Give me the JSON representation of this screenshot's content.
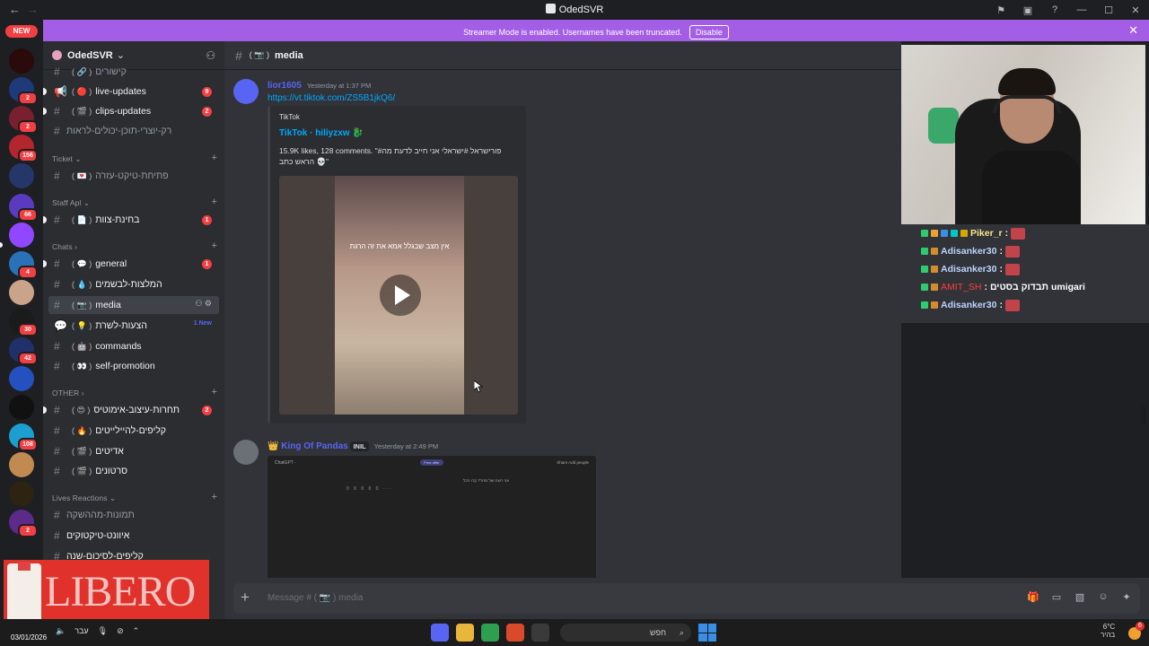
{
  "window": {
    "title": "OdedSVR"
  },
  "banner": {
    "message": "Streamer Mode is enabled. Usernames have been truncated.",
    "disable_label": "Disable"
  },
  "guild_bar": {
    "new_label": "NEW",
    "badges": [
      "2",
      "2",
      "156",
      "66",
      "4",
      "30",
      "42",
      "108",
      "2"
    ]
  },
  "server": {
    "name": "OdedSVR"
  },
  "sidebar": {
    "channels_top": [
      {
        "name": "קישורים",
        "emoji": "( 🔗 )"
      },
      {
        "name": "live-updates",
        "emoji": "( 🔴 )",
        "badge": "9"
      },
      {
        "name": "clips-updates",
        "emoji": "( 🎬 )",
        "badge": "2"
      },
      {
        "name": "רק-יוצרי-תוכן-יכולים-לראות",
        "emoji": ""
      }
    ],
    "categories": {
      "ticket": "Ticket",
      "staff": "Staff Apl",
      "chats": "Chats",
      "other": "OTHER",
      "lives": "Lives Reactions"
    },
    "ticket_channels": [
      {
        "name": "פתיחת-טיקט-עזרה",
        "emoji": "( 💌 )"
      }
    ],
    "staff_channels": [
      {
        "name": "בחינת-צוות",
        "emoji": "( 📄 )",
        "badge": "1"
      }
    ],
    "chat_channels": [
      {
        "name": "general",
        "emoji": "( 💬 )",
        "badge": "1"
      },
      {
        "name": "המלצות-לבשמים",
        "emoji": "( 💧 )"
      },
      {
        "name": "media",
        "emoji": "( 📷 )"
      },
      {
        "name": "הצעות-לשרת",
        "emoji": "( 💡 )",
        "tag": "1 New"
      },
      {
        "name": "commands",
        "emoji": "( 🤖 )"
      },
      {
        "name": "self-promotion",
        "emoji": "( 👀 )"
      }
    ],
    "other_channels": [
      {
        "name": "תחרות-עיצוב-אימוטיס",
        "emoji": "( 😍 )",
        "badge": "2"
      },
      {
        "name": "קליפים-להיילייטים",
        "emoji": "( 🔥 )"
      },
      {
        "name": "אדיטים",
        "emoji": "( 🎬 )"
      },
      {
        "name": "סרטונים",
        "emoji": "( 🎬 )"
      }
    ],
    "lives_channels": [
      {
        "name": "תמונות-מההשקה",
        "emoji": ""
      },
      {
        "name": "איוונט-טיקטוקים",
        "emoji": ""
      },
      {
        "name": "קליפים-לסיכום-שנה",
        "emoji": ""
      }
    ]
  },
  "topbar": {
    "channel": "media",
    "emoji": "( 📷 )"
  },
  "messages": [
    {
      "author": "lior1605",
      "timestamp": "Yesterday at 1:37 PM",
      "link": "https://vt.tiktok.com/ZS5B1jkQ6/",
      "embed": {
        "provider": "TikTok",
        "title": "TikTok · hiliyzxw 🐉",
        "description": "15.9K likes, 128 comments. \"פורישראל #ישראלי אני חייב לדעת מה# הראש כתב 💀\"",
        "video_caption": "אין מצב שבגלל אמא את זה הרגת"
      },
      "author_color": "#5865f2"
    },
    {
      "author": "King Of Pandas",
      "crown": "👑",
      "tag": "INIL",
      "timestamp": "Yesterday at 2:49 PM",
      "image": {
        "app": "ChatGPT ·",
        "pill": "Free offer",
        "share": "Share   Add people",
        "dots": "0 0 0 0 0 ···",
        "bubble": "אני רוצה של מחר? קרו הכל"
      },
      "author_color": "#5865f2"
    }
  ],
  "composer": {
    "placeholder": "Message #  ( 📷 )  media"
  },
  "stream_chat": [
    {
      "user": "Piker_r",
      "text": ":"
    },
    {
      "user": "Adisanker30",
      "text": ":"
    },
    {
      "user": "Adisanker30",
      "text": ":"
    },
    {
      "user": "AMIT_SH",
      "text": ": תבדוק בסטים umigari"
    },
    {
      "user": "Adisanker30",
      "text": ":"
    }
  ],
  "overlay": {
    "brand": "LIBERO"
  },
  "taskbar": {
    "date": "03/01/2026",
    "lang": "עבר",
    "search": "חפש",
    "temp": "6°C",
    "weather_desc": "בהיר",
    "notif_count": "6"
  },
  "colors": {
    "banner": "#a45ee5",
    "unread_badge": "#f23f43",
    "link": "#00a8fc",
    "active_channel": "#404249"
  }
}
